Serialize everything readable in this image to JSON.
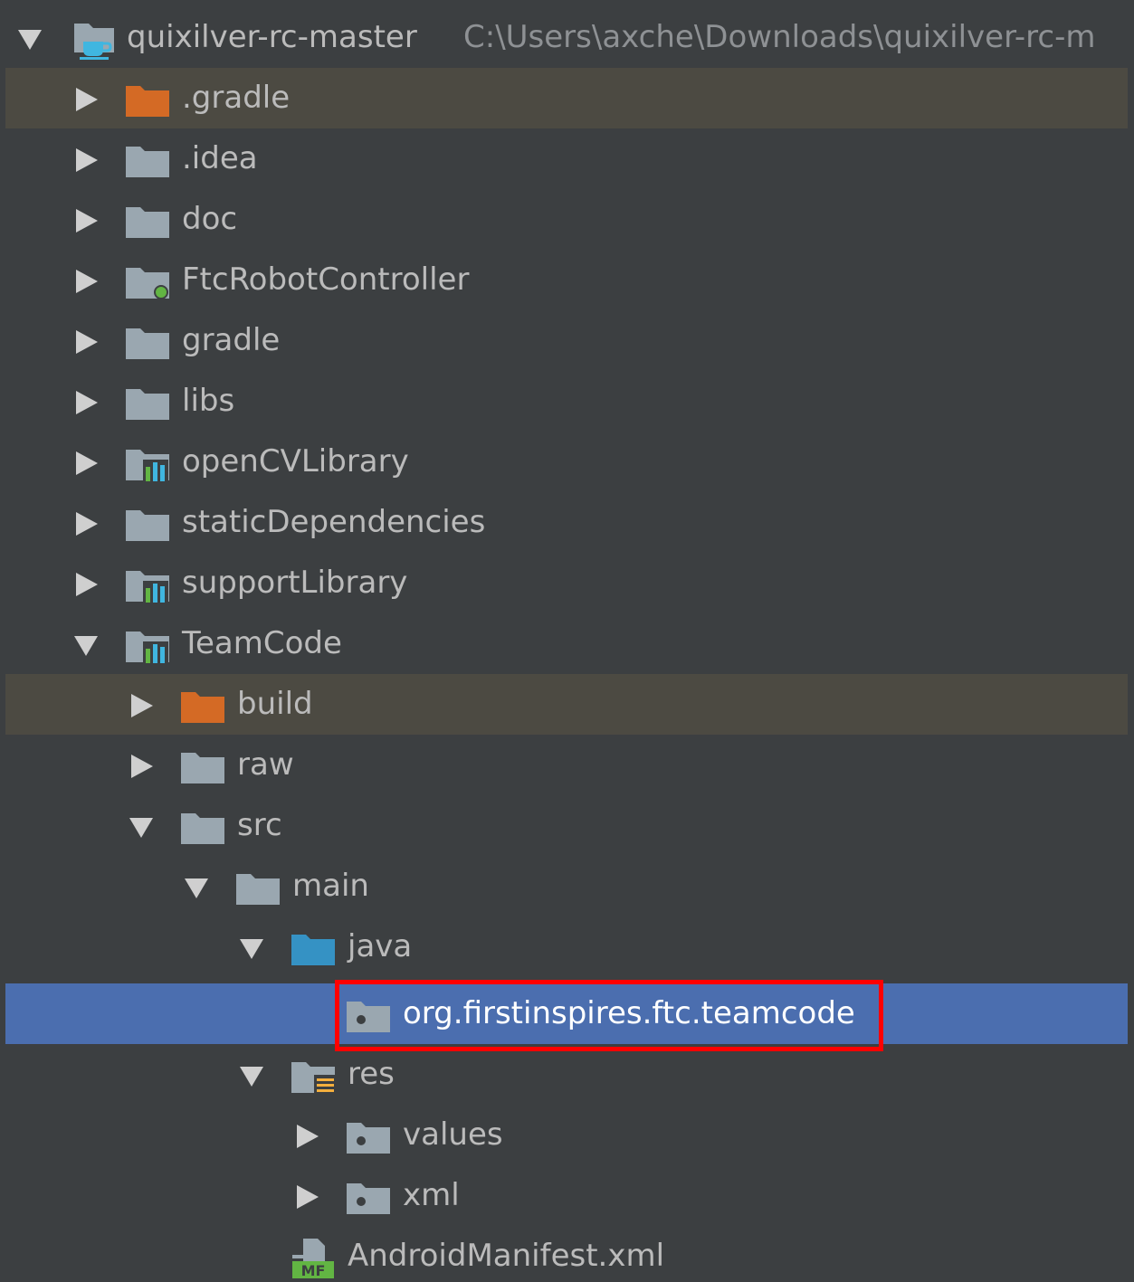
{
  "tree": {
    "project": {
      "name": "quixilver-rc-master",
      "path": "C:\\Users\\axche\\Downloads\\quixilver-rc-m"
    },
    "items": [
      {
        "label": ".gradle"
      },
      {
        "label": ".idea"
      },
      {
        "label": "doc"
      },
      {
        "label": "FtcRobotController"
      },
      {
        "label": "gradle"
      },
      {
        "label": "libs"
      },
      {
        "label": "openCVLibrary"
      },
      {
        "label": "staticDependencies"
      },
      {
        "label": "supportLibrary"
      },
      {
        "label": "TeamCode"
      },
      {
        "label": "build"
      },
      {
        "label": "raw"
      },
      {
        "label": "src"
      },
      {
        "label": "main"
      },
      {
        "label": "java"
      },
      {
        "label": "org.firstinspires.ftc.teamcode"
      },
      {
        "label": "res"
      },
      {
        "label": "values"
      },
      {
        "label": "xml"
      },
      {
        "label": "AndroidManifest.xml"
      }
    ]
  },
  "icons": {
    "manifest_badge": "MF"
  },
  "colors": {
    "background": "#3c3f41",
    "selection": "#4b6eaf",
    "excluded_row": "#4c4a42",
    "highlight_border": "#ff0000",
    "folder_excluded": "#d46a25",
    "folder_source": "#3592c4",
    "folder_default": "#9aa7b0"
  }
}
